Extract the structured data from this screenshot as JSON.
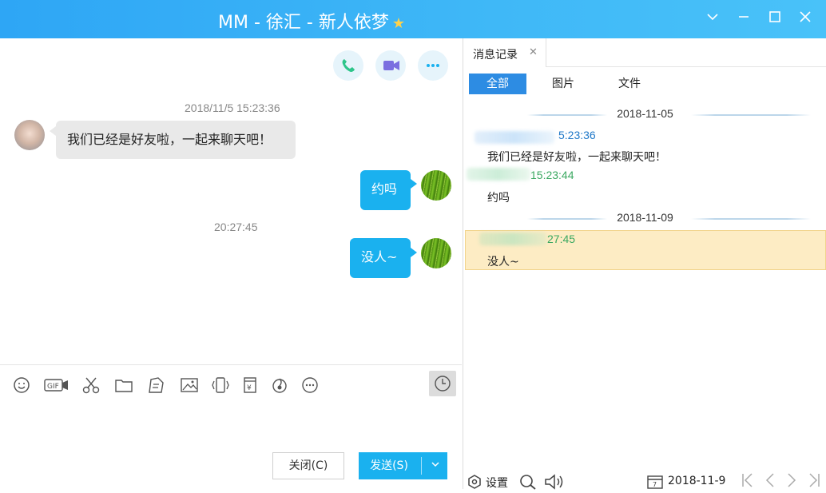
{
  "window": {
    "title": "MM - 徐汇 - 新人依梦",
    "star_icon": "star-badge-icon",
    "controls": [
      "chevron-down-icon",
      "minimize-icon",
      "maximize-icon",
      "close-icon"
    ]
  },
  "chat": {
    "header_actions": [
      "phone-icon",
      "video-icon",
      "more-icon"
    ],
    "messages": [
      {
        "timestamp": "2018/11/5 15:23:36",
        "side": "left",
        "text": "我们已经是好友啦，一起来聊天吧！"
      },
      {
        "side": "right",
        "text": "约吗"
      },
      {
        "timestamp": "20:27:45",
        "side": "right",
        "text": "没人~"
      }
    ],
    "toolbar_icons": [
      "emoji-icon",
      "gif-icon",
      "scissors-icon",
      "folder-icon",
      "doc-icon",
      "image-icon",
      "shake-icon",
      "redpacket-icon",
      "music-icon",
      "more-icon",
      "history-clock-icon"
    ],
    "close_button": "关闭(C)",
    "send_button": "发送(S)"
  },
  "history": {
    "tab_label": "消息记录",
    "filters": [
      "全部",
      "图片",
      "文件"
    ],
    "active_filter": "全部",
    "groups": [
      {
        "date": "2018-11-05",
        "entries": [
          {
            "time": "5:23:36",
            "text": "我们已经是好友啦，一起来聊天吧！",
            "color": "#1f78c8"
          },
          {
            "time": "15:23:44",
            "text": "约吗",
            "color": "#3aa860"
          }
        ]
      },
      {
        "date": "2018-11-09",
        "entries": [
          {
            "time": "27:45",
            "text": "没人~",
            "color": "#3aa860",
            "highlighted": true
          }
        ]
      }
    ],
    "footer": {
      "settings_label": "设置",
      "date": "2018-11-9"
    }
  },
  "colors": {
    "accent": "#1ab1ef",
    "title_bar": "#2ea6f5",
    "highlight": "#fdecc4"
  }
}
